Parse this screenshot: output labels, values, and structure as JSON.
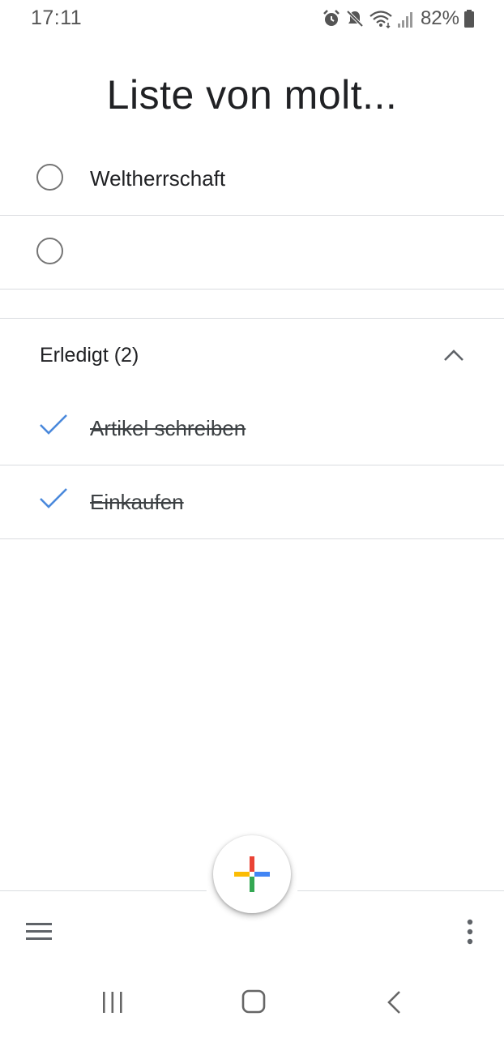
{
  "status_bar": {
    "time": "17:11",
    "battery": "82%",
    "icons": [
      "alarm-icon",
      "mute-icon",
      "wifi-icon",
      "signal-icon",
      "battery-icon"
    ]
  },
  "list": {
    "title": "Liste von molt..."
  },
  "open_tasks": [
    {
      "label": "Weltherrschaft"
    },
    {
      "label": ""
    }
  ],
  "completed": {
    "header": "Erledigt (2)",
    "items": [
      {
        "label": "Artikel schreiben"
      },
      {
        "label": "Einkaufen"
      }
    ]
  },
  "colors": {
    "check": "#4a89dc",
    "fab_red": "#ea4335",
    "fab_blue": "#4285f4",
    "fab_green": "#34a853",
    "fab_yellow": "#fbbc04"
  },
  "bottom_bar": {
    "icons": [
      "menu-icon",
      "add-task-fab",
      "more-options-icon"
    ]
  },
  "nav_bar": {
    "icons": [
      "recent-apps-icon",
      "home-icon",
      "back-icon"
    ]
  }
}
